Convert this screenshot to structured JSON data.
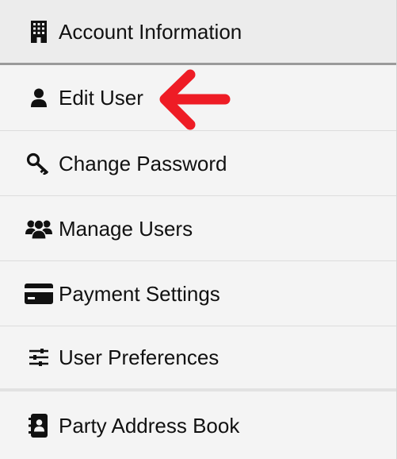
{
  "menu": {
    "header": {
      "label": "Account Information",
      "icon": "building-icon"
    },
    "items": [
      {
        "label": "Edit User",
        "icon": "user-icon"
      },
      {
        "label": "Change Password",
        "icon": "key-icon"
      },
      {
        "label": "Manage Users",
        "icon": "users-group-icon"
      },
      {
        "label": "Payment Settings",
        "icon": "credit-card-icon"
      },
      {
        "label": "User Preferences",
        "icon": "sliders-icon"
      },
      {
        "label": "Party Address Book",
        "icon": "address-book-icon"
      }
    ]
  },
  "annotation": {
    "arrow_color": "#ee1c25",
    "points_to": "Edit User"
  }
}
